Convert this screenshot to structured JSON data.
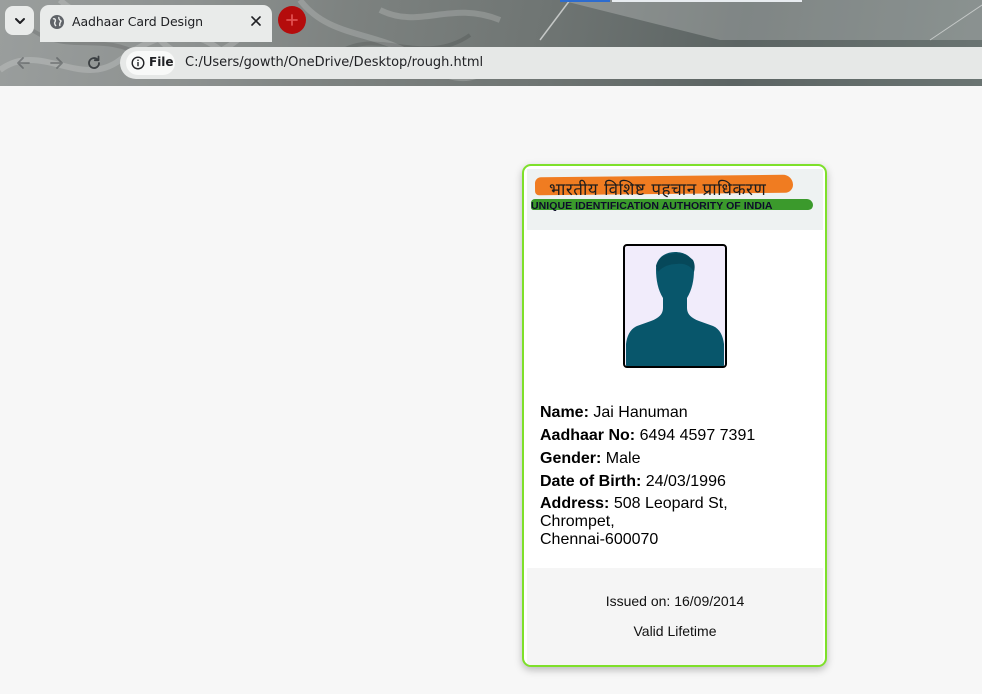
{
  "browser": {
    "tab_title": "Aadhaar Card Design",
    "site_chip_label": "File",
    "url": "C:/Users/gowth/OneDrive/Desktop/rough.html",
    "icons": {
      "tab_dropdown": "chevron-down-icon",
      "favicon": "globe-icon",
      "tab_close": "close-icon",
      "new_tab": "plus-icon",
      "back": "arrow-left-icon",
      "forward": "arrow-right-icon",
      "reload": "reload-icon",
      "site_info": "info-icon"
    }
  },
  "card": {
    "header": {
      "hindi_title": "भारतीय  विशिष्ट पहचान प्राधिकरण",
      "english_title": "UNIQUE IDENTIFICATION AUTHORITY OF INDIA"
    },
    "photo_icon": "person-silhouette-icon",
    "details": {
      "name_label": "Name:",
      "name_value": "Jai Hanuman",
      "aadhaar_label": "Aadhaar No:",
      "aadhaar_value": "6494 4597 7391",
      "gender_label": "Gender:",
      "gender_value": "Male",
      "dob_label": "Date of Birth:",
      "dob_value": "24/03/1996",
      "address_label": "Address:",
      "address_line1": "508 Leopard St,",
      "address_line2": "Chrompet,",
      "address_line3": "Chennai-600070"
    },
    "footer": {
      "issued": "Issued on: 16/09/2014",
      "validity": "Valid Lifetime"
    }
  },
  "colors": {
    "card_border": "#7ee02a",
    "saffron": "#f07c21",
    "green": "#3b9a2c",
    "photo_bg": "#f1ecfb",
    "silhouette": "#08566b",
    "new_tab": "#b40c0c"
  }
}
